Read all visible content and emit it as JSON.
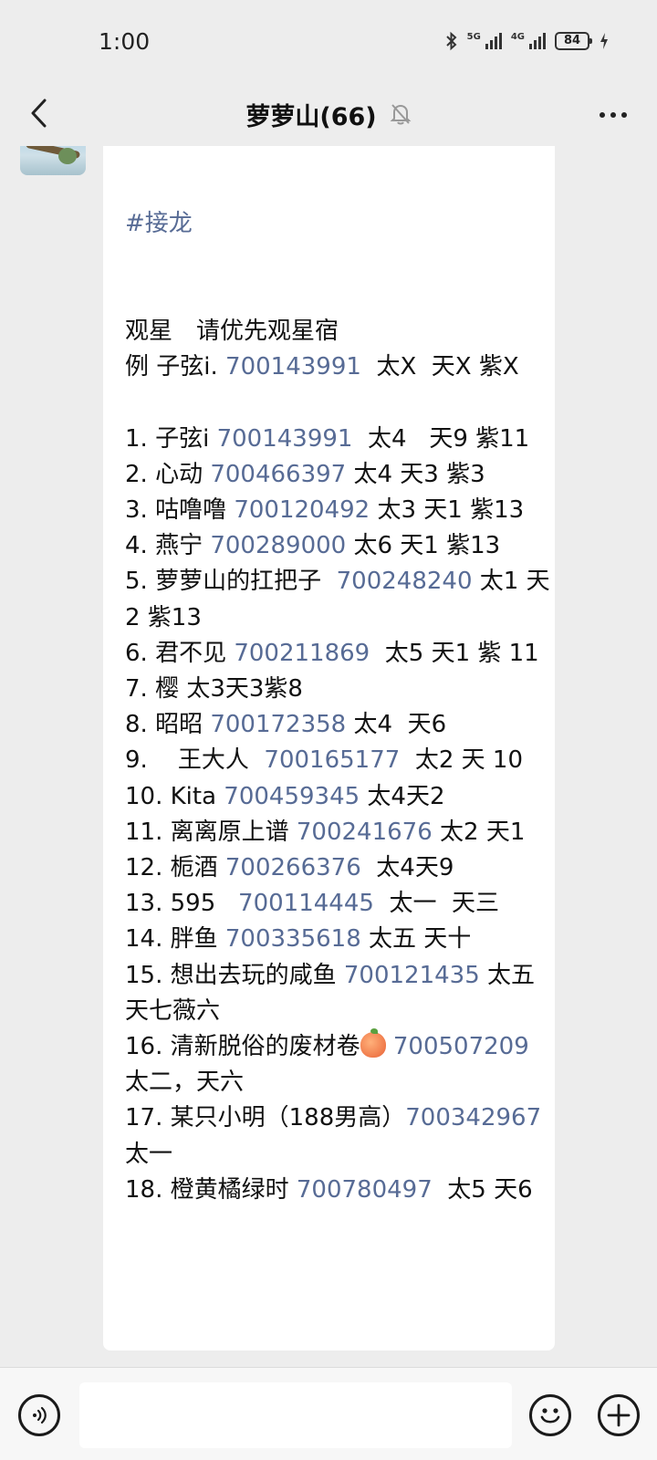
{
  "status_bar": {
    "time": "1:00",
    "network1": "5G",
    "network2": "4G",
    "battery": "84"
  },
  "header": {
    "title": "萝萝山(66)"
  },
  "message": {
    "hashtag": "#接龙",
    "lines": [
      {
        "parts": [
          {
            "t": "观星　请优先观星宿"
          }
        ]
      },
      {
        "parts": [
          {
            "t": "例 子弦i. "
          },
          {
            "t": "700143991",
            "link": true
          },
          {
            "t": "  太X  天X 紫X"
          }
        ]
      },
      {
        "parts": [
          {
            "t": " "
          }
        ]
      },
      {
        "parts": [
          {
            "t": "1. 子弦i "
          },
          {
            "t": "700143991",
            "link": true
          },
          {
            "t": "  太4   天9 紫11"
          }
        ]
      },
      {
        "parts": [
          {
            "t": "2. 心动 "
          },
          {
            "t": "700466397",
            "link": true
          },
          {
            "t": " 太4 天3 紫3"
          }
        ]
      },
      {
        "parts": [
          {
            "t": "3. 咕噜噜 "
          },
          {
            "t": "700120492",
            "link": true
          },
          {
            "t": " 太3 天1 紫13"
          }
        ]
      },
      {
        "parts": [
          {
            "t": "4. 燕宁 "
          },
          {
            "t": "700289000",
            "link": true
          },
          {
            "t": " 太6 天1 紫13"
          }
        ]
      },
      {
        "parts": [
          {
            "t": "5. 萝萝山的扛把子  "
          },
          {
            "t": "700248240",
            "link": true
          },
          {
            "t": " 太1 天2 紫13"
          }
        ]
      },
      {
        "parts": [
          {
            "t": "6. 君不见 "
          },
          {
            "t": "700211869",
            "link": true
          },
          {
            "t": "  太5 天1 紫 11"
          }
        ]
      },
      {
        "parts": [
          {
            "t": "7. 樱 太3天3紫8"
          }
        ]
      },
      {
        "parts": [
          {
            "t": "8. 昭昭 "
          },
          {
            "t": "700172358",
            "link": true
          },
          {
            "t": " 太4  天6"
          }
        ]
      },
      {
        "parts": [
          {
            "t": "9.    王大人  "
          },
          {
            "t": "700165177",
            "link": true
          },
          {
            "t": "  太2 天 10"
          }
        ]
      },
      {
        "parts": [
          {
            "t": "10. Kita "
          },
          {
            "t": "700459345",
            "link": true
          },
          {
            "t": " 太4天2"
          }
        ]
      },
      {
        "parts": [
          {
            "t": "11. 离离原上谱 "
          },
          {
            "t": "700241676",
            "link": true
          },
          {
            "t": " 太2 天1"
          }
        ]
      },
      {
        "parts": [
          {
            "t": "12. 栀酒 "
          },
          {
            "t": "700266376",
            "link": true
          },
          {
            "t": "  太4天9"
          }
        ]
      },
      {
        "parts": [
          {
            "t": "13. 595   "
          },
          {
            "t": "700114445",
            "link": true
          },
          {
            "t": "  太一  天三"
          }
        ]
      },
      {
        "parts": [
          {
            "t": "14. 胖鱼 "
          },
          {
            "t": "700335618",
            "link": true
          },
          {
            "t": " 太五 天十"
          }
        ]
      },
      {
        "parts": [
          {
            "t": "15. 想出去玩的咸鱼 "
          },
          {
            "t": "700121435",
            "link": true
          },
          {
            "t": " 太五天七薇六"
          }
        ]
      },
      {
        "parts": [
          {
            "t": "16. 清新脱俗的废材卷"
          },
          {
            "peach": true
          },
          {
            "t": " "
          },
          {
            "t": "700507209",
            "link": true
          },
          {
            "t": "       太二，天六"
          }
        ]
      },
      {
        "parts": [
          {
            "t": "17. 某只小明（188男高）"
          },
          {
            "t": "700342967",
            "link": true
          },
          {
            "t": "太一"
          }
        ]
      },
      {
        "parts": [
          {
            "t": "18. 橙黄橘绿时 "
          },
          {
            "t": "700780497",
            "link": true
          },
          {
            "t": "  太5 天6"
          }
        ]
      }
    ]
  },
  "colors": {
    "link": "#576b95",
    "background": "#ededed",
    "bubble": "#ffffff"
  },
  "icons": {
    "back": "chevron-left-icon",
    "mute": "bell-slash-icon",
    "more": "more-dots-icon",
    "voice": "voice-icon",
    "emoji": "emoji-icon",
    "plus": "plus-icon"
  }
}
